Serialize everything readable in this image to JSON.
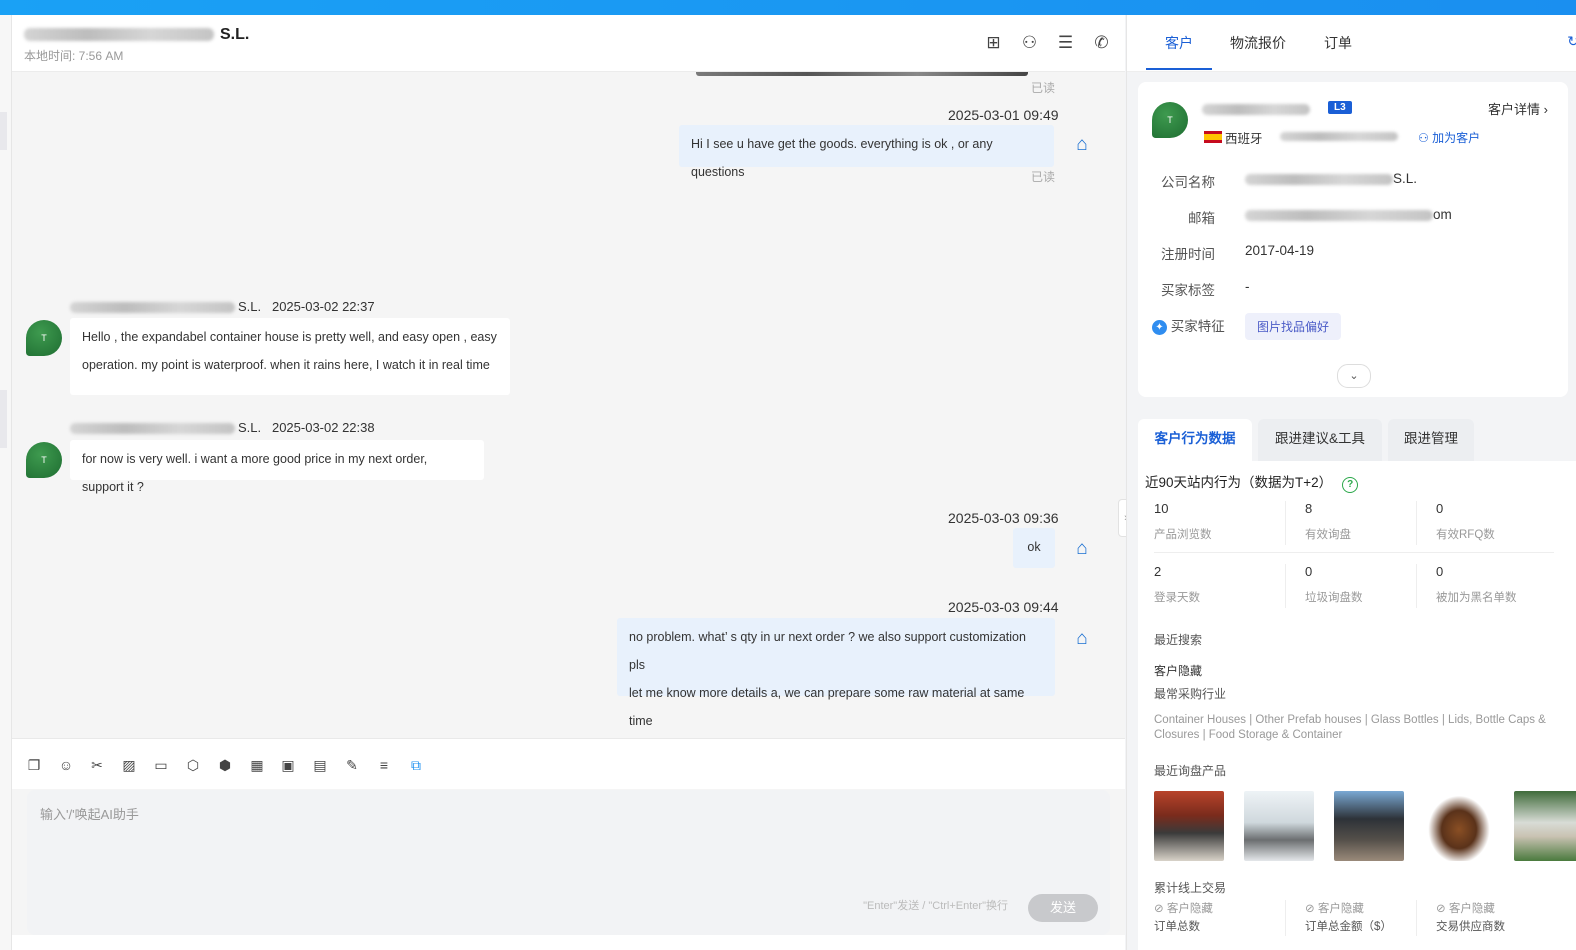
{
  "colors": {
    "accent": "#1a5fd6",
    "outgoing_bubble": "#e8f1fc",
    "send_disabled": "#c8c9cc"
  },
  "chat": {
    "title_suffix": "S.L.",
    "local_time": "本地时间: 7:56 AM",
    "header_icons": [
      "add-note-icon",
      "add-contact-icon",
      "search-chat-icon",
      "phone-icon"
    ],
    "read_label": "已读",
    "messages": {
      "m1": {
        "time": "2025-03-01 09:49",
        "text": "Hi I see u have get the goods.  everything is ok , or any questions"
      },
      "m2": {
        "sender_suffix": "S.L.",
        "time": "2025-03-02 22:37",
        "line1": "Hello , the expandabel container house is pretty well,    and easy open , easy",
        "line2": "operation. my point is waterproof.  when it rains here,  I watch it in real time"
      },
      "m3": {
        "sender_suffix": "S.L.",
        "time": "2025-03-02 22:38",
        "text": "for now is very well. i want a more good price in my next order, support it ?"
      },
      "m4": {
        "time": "2025-03-03 09:36",
        "text": "ok"
      },
      "m5": {
        "time": "2025-03-03 09:44",
        "line1": "no problem.  what’ s qty in ur next order ?  we also support customization  pls",
        "line2": "let me know more details a,  we can prepare some raw material at same time"
      }
    },
    "input_placeholder": "输入'/'唤起AI助手",
    "input_hint": "\"Enter\"发送 / \"Ctrl+Enter\"换行",
    "send_label": "发送"
  },
  "right": {
    "tabs": [
      "客户",
      "物流报价",
      "订单"
    ],
    "badge": "L3",
    "detail_link": "客户详情",
    "country": "西班牙",
    "add_customer": "加为客户",
    "fields": {
      "company_label": "公司名称",
      "company_suffix": "S.L.",
      "email_label": "邮箱",
      "email_suffix": "om",
      "reg_label": "注册时间",
      "reg_value": "2017-04-19",
      "tags_label": "买家标签",
      "tags_value": "-",
      "feature_label": "买家特征",
      "feature_tag": "图片找品偏好"
    },
    "subtabs": [
      "客户行为数据",
      "跟进建议&工具",
      "跟进管理"
    ],
    "behavior_title": "近90天站内行为（数据为T+2）",
    "stats": [
      {
        "value": "10",
        "label": "产品浏览数"
      },
      {
        "value": "8",
        "label": "有效询盘"
      },
      {
        "value": "0",
        "label": "有效RFQ数"
      },
      {
        "value": "2",
        "label": "登录天数"
      },
      {
        "value": "0",
        "label": "垃圾询盘数"
      },
      {
        "value": "0",
        "label": "被加为黑名单数"
      }
    ],
    "recent_search": "最近搜索",
    "customer_hidden": "客户隐藏",
    "industry_title": "最常采购行业",
    "industry_line1": "Container Houses | Other Prefab houses | Glass Bottles | Lids, Bottle Caps &",
    "industry_line2": "Closures | Food Storage & Container",
    "recent_products": "最近询盘产品",
    "online_trade": "累计线上交易",
    "trade": [
      {
        "hidden": "客户隐藏",
        "label": "订单总数"
      },
      {
        "hidden": "客户隐藏",
        "label": "订单总金额（$）"
      },
      {
        "hidden": "客户隐藏",
        "label": "交易供应商数"
      }
    ]
  }
}
